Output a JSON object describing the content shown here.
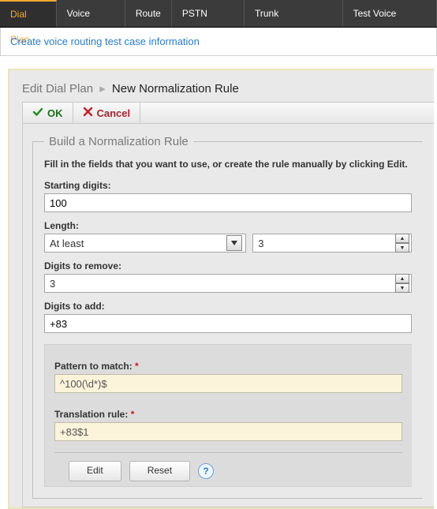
{
  "nav": {
    "tabs": [
      "Dial Plan",
      "Voice Policy",
      "Route",
      "PSTN Usage",
      "Trunk Configuration",
      "Test Voice Routing"
    ],
    "active_index": 0
  },
  "sub_link": "Create voice routing test case information",
  "breadcrumb": {
    "parent": "Edit Dial Plan",
    "current": "New Normalization Rule"
  },
  "toolbar": {
    "ok_label": "OK",
    "cancel_label": "Cancel"
  },
  "rule": {
    "legend": "Build a Normalization Rule",
    "instructions": "Fill in the fields that you want to use, or create the rule manually by clicking Edit.",
    "starting_digits_label": "Starting digits:",
    "starting_digits_value": "100",
    "length_label": "Length:",
    "length_mode": "At least",
    "length_value": "3",
    "digits_remove_label": "Digits to remove:",
    "digits_remove_value": "3",
    "digits_add_label": "Digits to add:",
    "digits_add_value": "+83",
    "pattern_label": "Pattern to match:",
    "pattern_value": "^100(\\d*)$",
    "translation_label": "Translation rule:",
    "translation_value": "+83$1",
    "edit_label": "Edit",
    "reset_label": "Reset",
    "required_mark": "*",
    "help_char": "?"
  }
}
